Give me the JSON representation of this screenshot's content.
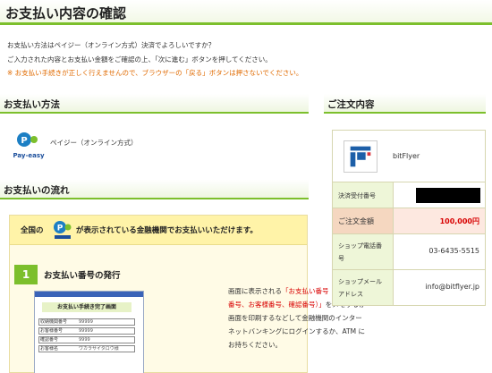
{
  "page": {
    "title": "お支払い内容の確認"
  },
  "intro": {
    "line1": "お支払い方法はペイジー（オンライン方式）決済でよろしいですか？",
    "line2": "ご入力された内容とお支払い金額をご確認の上、「次に進む」ボタンを押してください。",
    "warning": "※ お支払い手続きが正しく行えませんので、ブラウザーの「戻る」ボタンは押さないでください。"
  },
  "payment_method": {
    "header": "お支払い方法",
    "name": "ペイジー（オンライン方式）",
    "logo_text": "Pay-easy"
  },
  "flow": {
    "header": "お支払いの流れ",
    "banner_prefix": "全国の",
    "banner_suffix": "が表示されている金融機関でお支払いいただけます。",
    "step_number": "1",
    "step_title": "お支払い番号の発行",
    "screenshot": {
      "heading": "お支払い手続き完了画面",
      "rows": [
        {
          "label": "収納機関番号",
          "value": "99999"
        },
        {
          "label": "お客様番号",
          "value": "99999"
        },
        {
          "label": "確認番号",
          "value": "9999"
        },
        {
          "label": "お客様名",
          "value": "ワカラサイタロウ様"
        }
      ]
    },
    "description": {
      "l1_a": "画面に表示される",
      "l1_b": "「お支払い番号（収納機関",
      "l2": "番号、お客様番号、確認番号）」",
      "l2_b": "をメモするか",
      "l3": "画面を印刷するなどして金融機関のインター",
      "l4": "ネットバンキングにログインするか、ATM に",
      "l5": "お持ちください。"
    }
  },
  "order": {
    "header": "ご注文内容",
    "shop_name": "bitFlyer",
    "rows": {
      "receipt_label": "決済受付番号",
      "total_label": "ご注文金額",
      "total_value": "100,000円",
      "phone_label_1": "ショップ電話番",
      "phone_label_2": "号",
      "phone_value": "03-6435-5515",
      "mail_label_1": "ショップメール",
      "mail_label_2": "アドレス",
      "mail_value": "info@bitflyer.jp"
    }
  },
  "colors": {
    "accent_green": "#7cbf2c",
    "warning_orange": "#e06a00",
    "highlight_red": "#d80000"
  }
}
